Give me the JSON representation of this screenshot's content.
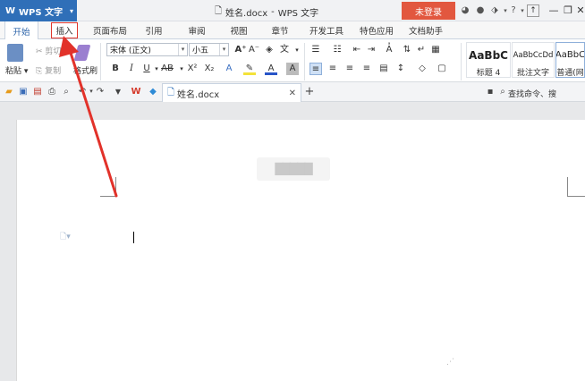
{
  "app": {
    "name": "WPS 文字",
    "logo": "W"
  },
  "title": {
    "doc_name": "姓名.docx",
    "separator": "-",
    "app_name": "WPS 文字"
  },
  "login_label": "未登录",
  "title_icons": [
    "skin-icon",
    "settings-icon",
    "share-icon",
    "help-icon",
    "help-menu-icon"
  ],
  "tabs": [
    "开始",
    "插入",
    "页面布局",
    "引用",
    "审阅",
    "视图",
    "章节",
    "开发工具",
    "特色应用",
    "文档助手"
  ],
  "clipboard": {
    "paste": "粘贴",
    "cut": "剪切",
    "copy": "复制",
    "format_painter": "格式刷"
  },
  "font": {
    "name": "宋体 (正文)",
    "size": "小五"
  },
  "format_buttons": [
    "B",
    "I",
    "U",
    "AB",
    "X²",
    "X₂"
  ],
  "styles": [
    {
      "sample": "AaBbC",
      "name": "标题 4"
    },
    {
      "sample": "AaBbCcDd",
      "name": "批注文字"
    },
    {
      "sample": "AaBbC",
      "name": "普通(网"
    }
  ],
  "doc_tab": {
    "name": "姓名.docx"
  },
  "quick_right": {
    "search_label": "查找命令、搜"
  },
  "page": {
    "header_placeholder": "█████"
  },
  "colors": {
    "accent": "#2f6fb8",
    "login": "#e2573f",
    "arrow": "#e2322a",
    "highlight_box": "#e0352b"
  }
}
